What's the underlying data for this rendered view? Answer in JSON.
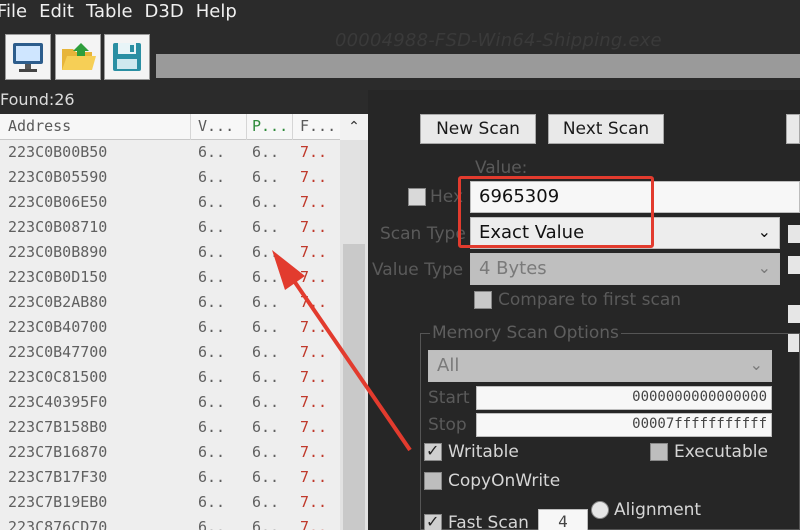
{
  "menu": {
    "items": [
      "File",
      "Edit",
      "Table",
      "D3D",
      "Help"
    ]
  },
  "toolbar": {
    "process_title": "00004988-FSD-Win64-Shipping.exe",
    "buttons": [
      {
        "name": "open-process",
        "icon": "computer-icon"
      },
      {
        "name": "open-file",
        "icon": "folder-open-icon"
      },
      {
        "name": "save",
        "icon": "floppy-disk-icon"
      }
    ]
  },
  "found_label": "Found:26",
  "list": {
    "headers": {
      "address": "Address",
      "value": "V...",
      "previous": "P...",
      "first": "F..."
    },
    "rows": [
      {
        "address": "223C0B00B50",
        "value": "6..",
        "previous": "6..",
        "first": "7.."
      },
      {
        "address": "223C0B05590",
        "value": "6..",
        "previous": "6..",
        "first": "7.."
      },
      {
        "address": "223C0B06E50",
        "value": "6..",
        "previous": "6..",
        "first": "7.."
      },
      {
        "address": "223C0B08710",
        "value": "6..",
        "previous": "6..",
        "first": "7.."
      },
      {
        "address": "223C0B0B890",
        "value": "6..",
        "previous": "6..",
        "first": "7.."
      },
      {
        "address": "223C0B0D150",
        "value": "6..",
        "previous": "6..",
        "first": "7.."
      },
      {
        "address": "223C0B2AB80",
        "value": "6..",
        "previous": "6..",
        "first": "7.."
      },
      {
        "address": "223C0B40700",
        "value": "6..",
        "previous": "6..",
        "first": "7.."
      },
      {
        "address": "223C0B47700",
        "value": "6..",
        "previous": "6..",
        "first": "7.."
      },
      {
        "address": "223C0C81500",
        "value": "6..",
        "previous": "6..",
        "first": "7.."
      },
      {
        "address": "223C40395F0",
        "value": "6..",
        "previous": "6..",
        "first": "7.."
      },
      {
        "address": "223C7B158B0",
        "value": "6..",
        "previous": "6..",
        "first": "7.."
      },
      {
        "address": "223C7B16870",
        "value": "6..",
        "previous": "6..",
        "first": "7.."
      },
      {
        "address": "223C7B17F30",
        "value": "6..",
        "previous": "6..",
        "first": "7.."
      },
      {
        "address": "223C7B19EB0",
        "value": "6..",
        "previous": "6..",
        "first": "7.."
      },
      {
        "address": "223C876CD70",
        "value": "6..",
        "previous": "6..",
        "first": "7.."
      }
    ]
  },
  "scan": {
    "new_scan_label": "New Scan",
    "next_scan_label": "Next Scan",
    "value_label": "Value:",
    "hex_label": "Hex",
    "value": "6965309",
    "scan_type_label": "Scan Type",
    "scan_type_value": "Exact Value",
    "value_type_label": "Value Type",
    "value_type_value": "4 Bytes",
    "compare_first_label": "Compare to first scan"
  },
  "memory_options": {
    "legend": "Memory Scan Options",
    "region_value": "All",
    "start_label": "Start",
    "start_value": "0000000000000000",
    "stop_label": "Stop",
    "stop_value": "00007fffffffffff",
    "writable_label": "Writable",
    "executable_label": "Executable",
    "copyonwrite_label": "CopyOnWrite",
    "fastscan_label": "Fast Scan",
    "fastscan_value": "4",
    "alignment_label": "Alignment"
  },
  "colors": {
    "highlight": "#e23b2e",
    "arrow": "#e23b2e",
    "first_column_text": "#c0392b"
  }
}
